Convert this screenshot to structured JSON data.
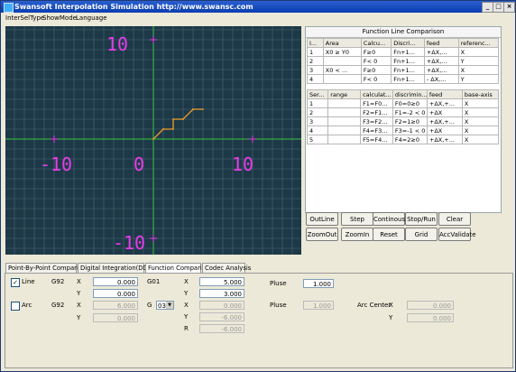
{
  "window": {
    "title": "Swansoft Interpolation Simulation http://www.swansc.com",
    "controls": {
      "minimize": "_",
      "maximize": "□",
      "close": "×"
    }
  },
  "menu": [
    "InterSelType",
    "ShowMode",
    "Language"
  ],
  "canvas": {
    "axis_labels": {
      "top": "10",
      "left": "-10",
      "origin": "0",
      "right": "10",
      "bottom": "-10"
    }
  },
  "function_panel": {
    "title": "Function Line Comparison",
    "table1": {
      "headers": [
        "I...",
        "Area",
        "Calcu...",
        "Discri...",
        "feed",
        "referenc..."
      ],
      "rows": [
        [
          "1",
          "X0 ≥ Y0",
          "F≥0",
          "Fn+1...",
          "+ΔX,...",
          "X"
        ],
        [
          "2",
          "",
          "F< 0",
          "Fn+1...",
          "+ΔX,...",
          "Y"
        ],
        [
          "3",
          "X0 < ...",
          "F≥0",
          "Fn+1...",
          "+ΔX,...",
          "X"
        ],
        [
          "4",
          "",
          "F< 0",
          "Fn+1...",
          "- ΔX,...",
          "Y"
        ]
      ]
    },
    "table2": {
      "headers": [
        "Ser...",
        "range",
        "calculat...",
        "discrimin...",
        "feed",
        "base-axis"
      ],
      "rows": [
        [
          "1",
          "",
          "F1=F0...",
          "F0=0≥0",
          "+ΔX,+...",
          "X"
        ],
        [
          "2",
          "",
          "F2=F1...",
          "F1=-2 < 0",
          "+ΔX",
          "X"
        ],
        [
          "3",
          "",
          "F3=F2...",
          "F2=1≥0",
          "+ΔX,+...",
          "X"
        ],
        [
          "4",
          "",
          "F4=F3...",
          "F3=-1 < 0",
          "+ΔX",
          "X"
        ],
        [
          "5",
          "",
          "F5=F4...",
          "F4=2≥0",
          "+ΔX,+...",
          "X"
        ]
      ]
    }
  },
  "buttons": {
    "outline": "OutLine",
    "step": "Step",
    "continous": "Continous",
    "stop_run": "Stop/Run",
    "clear": "Clear",
    "zoomout": "ZoomOut",
    "zoomin": "ZoomIn",
    "reset": "Reset",
    "grid": "Grid",
    "accvalidate": "AccValidate"
  },
  "tabs": [
    "Point-By-Point Comparison",
    "Digital Integration(DDA)",
    "Function Comparison",
    "Codec Analysis"
  ],
  "form": {
    "line_checked": "✓",
    "line_label": "Line",
    "arc_label": "Arc",
    "g92": "G92",
    "g92_arc": "G92",
    "x": "X",
    "y": "Y",
    "line_x": "0.000",
    "line_y": "0.000",
    "arc_x": "6.000",
    "arc_y": "0.000",
    "g01": "G01",
    "g01_x": "5.000",
    "g01_y": "3.000",
    "g_label": "G",
    "g_select": "03",
    "arc_gx": "0.000",
    "arc_gy": "-6.000",
    "r": "R",
    "arc_r": "-6.000",
    "pluse": "Pluse",
    "pluse_value": "1.000",
    "pluse2": "Pluse",
    "pluse2_value": "1.000",
    "arc_center": "Arc Center",
    "arc_center_x": "0.000",
    "arc_center_y": "0.000"
  },
  "colors": {
    "canvas_bg": "#1d3948",
    "grid_line": "#4e6672",
    "axis": "#39c43b",
    "label": "#e93ce9",
    "path": "#f0a02a"
  },
  "chart_data": {
    "type": "line",
    "xlim": [
      -15,
      15
    ],
    "ylim": [
      -11,
      11
    ],
    "series": [
      {
        "x": [
          0,
          1,
          1,
          2,
          2,
          3,
          3,
          4,
          4,
          5
        ],
        "y": [
          0,
          1,
          1,
          1,
          2,
          2,
          2,
          3,
          3,
          3
        ]
      }
    ]
  }
}
